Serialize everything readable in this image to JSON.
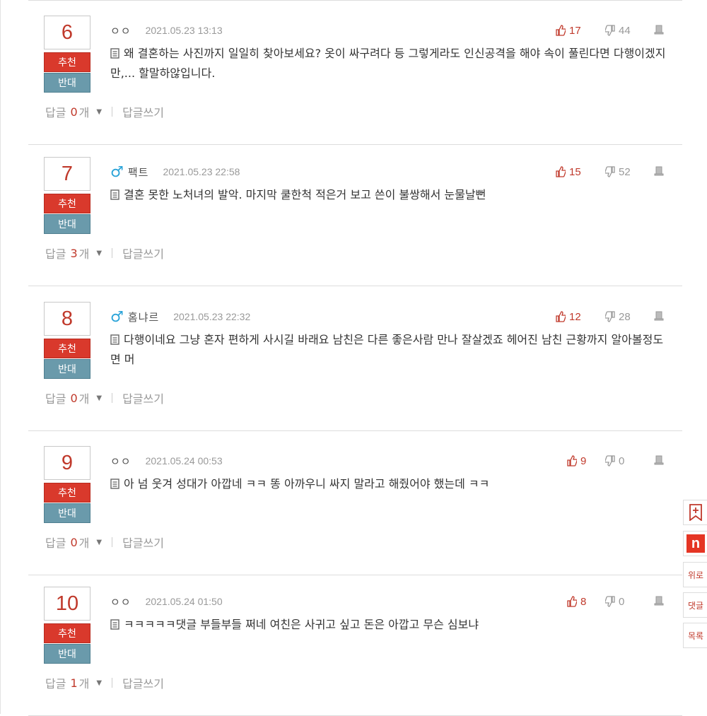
{
  "comments": [
    {
      "rank": "6",
      "gender": "",
      "nickname": "ㅇㅇ",
      "date": "2021.05.23 13:13",
      "likes": "17",
      "dislikes": "44",
      "text": "왜 결혼하는 사진까지 일일히 찾아보세요? 옷이 싸구려다 등 그렇게라도 인신공격을 해야 속이 풀린다면 다행이겠지만,... 할말하않입니다.",
      "reply_count": "0"
    },
    {
      "rank": "7",
      "gender": "male",
      "nickname": "팩트",
      "date": "2021.05.23 22:58",
      "likes": "15",
      "dislikes": "52",
      "text": "결혼 못한 노처녀의 발악. 마지막 쿨한척 적은거 보고 쓴이 불쌍해서 눈물날뻔",
      "reply_count": "3"
    },
    {
      "rank": "8",
      "gender": "male",
      "nickname": "홈냐르",
      "date": "2021.05.23 22:32",
      "likes": "12",
      "dislikes": "28",
      "text": "다행이네요 그냥 혼자 편하게 사시길 바래요 남친은 다른 좋은사람 만나 잘살겠죠 헤어진 남친 근황까지 알아볼정도면 머",
      "reply_count": "0"
    },
    {
      "rank": "9",
      "gender": "",
      "nickname": "ㅇㅇ",
      "date": "2021.05.24 00:53",
      "likes": "9",
      "dislikes": "0",
      "text": "아 넘 웃겨 성대가 아깝네 ㅋㅋ 똥 아까우니 싸지 말라고 해줬어야 했는데 ㅋㅋ",
      "reply_count": "0"
    },
    {
      "rank": "10",
      "gender": "",
      "nickname": "ㅇㅇ",
      "date": "2021.05.24 01:50",
      "likes": "8",
      "dislikes": "0",
      "text": "ㅋㅋㅋㅋㅋ댓글 부들부들 쩌네 여친은 사귀고 싶고 돈은 아깝고 무슨 심보냐",
      "reply_count": "1"
    }
  ],
  "labels": {
    "recommend": "추천",
    "oppose": "반대",
    "reply": "답글",
    "reply_unit": "개",
    "write_reply": "답글쓰기",
    "male_symbol": "♂"
  },
  "side_menu": {
    "bookmark": "+",
    "n_logo": "n",
    "top": "위로",
    "comments": "댓글",
    "list": "목록"
  },
  "colors": {
    "accent_red": "#d9392c",
    "oppose_blue": "#6a9aab",
    "male_blue": "#29a3d8"
  }
}
